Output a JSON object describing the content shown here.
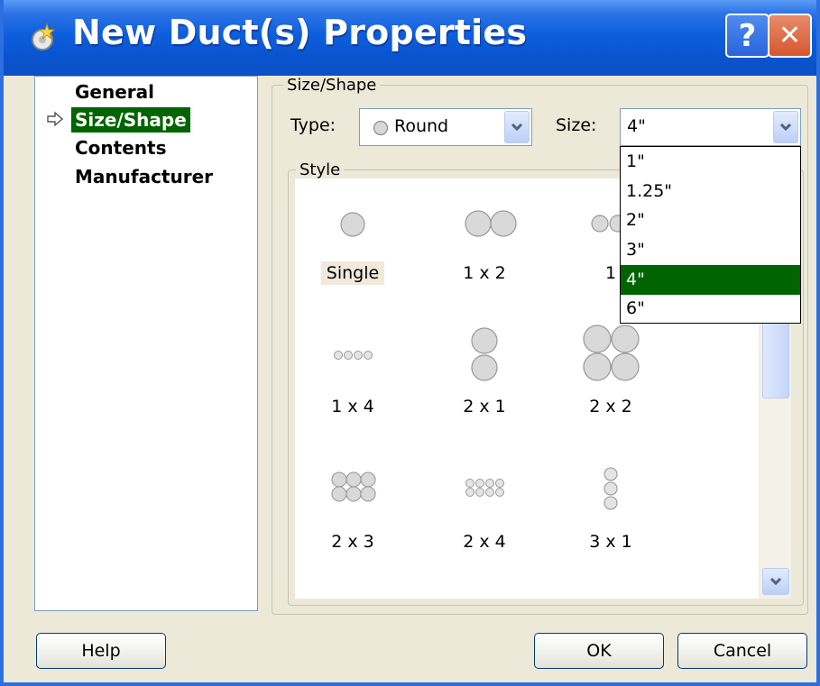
{
  "window": {
    "title": "New Duct(s) Properties",
    "help_glyph": "?",
    "close_glyph": "✕"
  },
  "nav": {
    "items": [
      {
        "label": "General",
        "selected": false
      },
      {
        "label": "Size/Shape",
        "selected": true
      },
      {
        "label": "Contents",
        "selected": false
      },
      {
        "label": "Manufacturer",
        "selected": false
      }
    ]
  },
  "size_shape": {
    "group_label": "Size/Shape",
    "type_label": "Type:",
    "type_value": "Round",
    "size_label": "Size:",
    "size_value": "4\"",
    "style_label": "Style"
  },
  "size_options": {
    "items": [
      "1\"",
      "1.25\"",
      "2\"",
      "3\"",
      "4\"",
      "6\""
    ],
    "selected": "4\""
  },
  "styles": {
    "items": [
      {
        "label": "Single",
        "selected": true
      },
      {
        "label": "1 x 2",
        "selected": false
      },
      {
        "label": "1",
        "selected": false
      },
      {
        "label": "1 x 4",
        "selected": false
      },
      {
        "label": "2 x 1",
        "selected": false
      },
      {
        "label": "2 x 2",
        "selected": false
      },
      {
        "label": "2 x 3",
        "selected": false
      },
      {
        "label": "2 x 4",
        "selected": false
      },
      {
        "label": "3 x 1",
        "selected": false
      }
    ]
  },
  "buttons": {
    "help": "Help",
    "ok": "OK",
    "cancel": "Cancel"
  },
  "colors": {
    "selection": "#006400",
    "title_bar": "#0a54cf",
    "dialog_bg": "#ece9d8"
  }
}
